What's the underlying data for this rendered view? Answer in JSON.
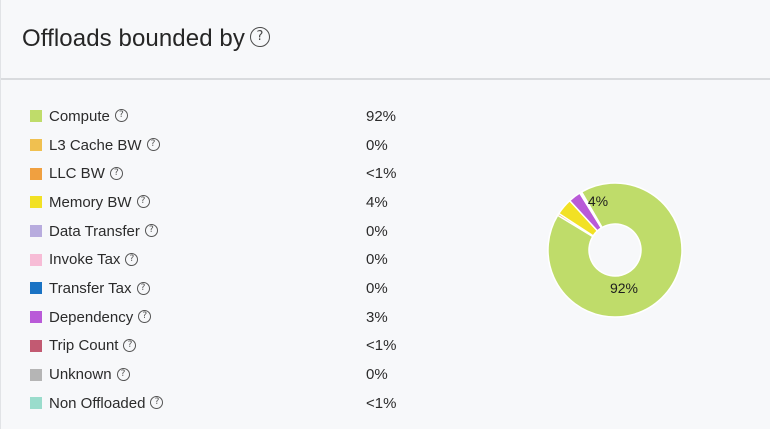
{
  "panel": {
    "title": "Offloads bounded by",
    "help_glyph": "?"
  },
  "legend": [
    {
      "label": "Compute",
      "value": "92%",
      "color": "#bfdc6a"
    },
    {
      "label": "L3 Cache BW",
      "value": "0%",
      "color": "#f0c050"
    },
    {
      "label": "LLC BW",
      "value": "<1%",
      "color": "#f0a040"
    },
    {
      "label": "Memory BW",
      "value": "4%",
      "color": "#f2e124"
    },
    {
      "label": "Data Transfer",
      "value": "0%",
      "color": "#b8acde"
    },
    {
      "label": "Invoke Tax",
      "value": "0%",
      "color": "#f7bcd6"
    },
    {
      "label": "Transfer Tax",
      "value": "0%",
      "color": "#1a73c4"
    },
    {
      "label": "Dependency",
      "value": "3%",
      "color": "#b95ad8"
    },
    {
      "label": "Trip Count",
      "value": "<1%",
      "color": "#c25a72"
    },
    {
      "label": "Unknown",
      "value": "0%",
      "color": "#b5b5b5"
    },
    {
      "label": "Non Offloaded",
      "value": "<1%",
      "color": "#9adccc"
    }
  ],
  "chart_data": {
    "type": "pie",
    "donut": true,
    "categories": [
      "Compute",
      "LLC BW",
      "Memory BW",
      "Dependency",
      "Trip Count",
      "Non Offloaded"
    ],
    "values": [
      92,
      0.5,
      4,
      3,
      0.3,
      0.2
    ],
    "colors": [
      "#bfdc6a",
      "#f0a040",
      "#f2e124",
      "#b95ad8",
      "#c25a72",
      "#9adccc"
    ],
    "slice_labels": [
      "92%",
      "",
      "4%",
      "",
      "",
      ""
    ]
  }
}
